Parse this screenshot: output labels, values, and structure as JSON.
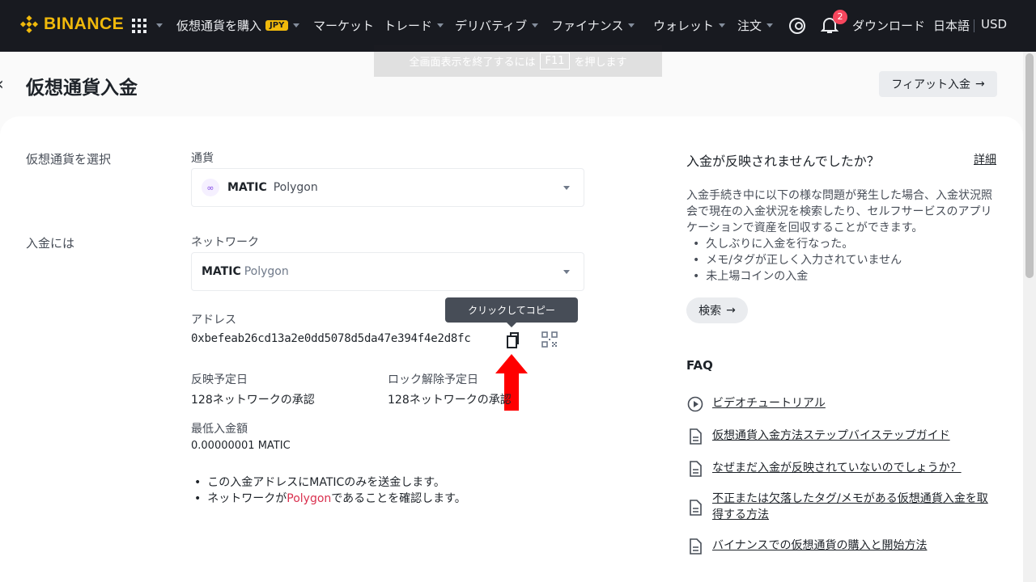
{
  "nav": {
    "logo": "BINANCE",
    "items": [
      "仮想通貨を購入",
      "マーケット",
      "トレード",
      "デリバティブ",
      "ファイナンス",
      "ウォレット",
      "注文"
    ],
    "jpy_badge": "JPY",
    "notification_count": "2",
    "download": "ダウンロード",
    "language": "日本語",
    "currency": "USD"
  },
  "fullscreen_notice": {
    "before": "全画面表示を終了するには",
    "key": "F11",
    "after": "を押します"
  },
  "header": {
    "title": "仮想通貨入金",
    "fiat_button": "フィアット入金"
  },
  "form": {
    "select_crypto_label": "仮想通貨を選択",
    "currency_label": "通貨",
    "currency_symbol": "MATIC",
    "currency_name": "Polygon",
    "deposit_to_label": "入金には",
    "network_label": "ネットワーク",
    "network_symbol": "MATIC",
    "network_name": "Polygon",
    "address_label": "アドレス",
    "address": "0xbefeab26cd13a2e0dd5078d5da47e394f4e2d8fc",
    "tooltip": "クリックしてコピー",
    "expected_arrival_label": "反映予定日",
    "expected_arrival": "128ネットワークの承認",
    "unlock_label": "ロック解除予定日",
    "unlock": "128ネットワークの承認",
    "min_deposit_label": "最低入金額",
    "min_deposit": "0.00000001 MATIC",
    "note1": "この入金アドレスにMATICのみを送金します。",
    "note2_a": "ネットワークが",
    "note2_b": "Polygon",
    "note2_c": "であることを確認します。"
  },
  "help": {
    "title": "入金が反映されませんでしたか？",
    "detail": "詳細",
    "paragraph": "入金手続き中に以下の様な問題が発生した場合、入金状況照会で現在の入金状況を検索したり、セルフサービスのアプリケーションで資産を回収することができます。",
    "bullets": [
      "久しぶりに入金を行なった。",
      "メモ/タグが正しく入力されていません",
      "未上場コインの入金"
    ],
    "search": "検索"
  },
  "faq": {
    "title": "FAQ",
    "items": [
      "ビデオチュートリアル",
      "仮想通貨入金方法ステップバイステップガイド",
      "なぜまだ入金が反映されていないのでしょうか？",
      "不正または欠落したタグ/メモがある仮想通貨入金を取得する方法",
      "バイナンスでの仮想通貨の購入と開始方法"
    ]
  },
  "colors": {
    "brand": "#f0b90b",
    "nav_bg": "#181a20",
    "badge": "#f6465d",
    "highlight": "#d9304e",
    "annotation_arrow": "#ff0000"
  }
}
